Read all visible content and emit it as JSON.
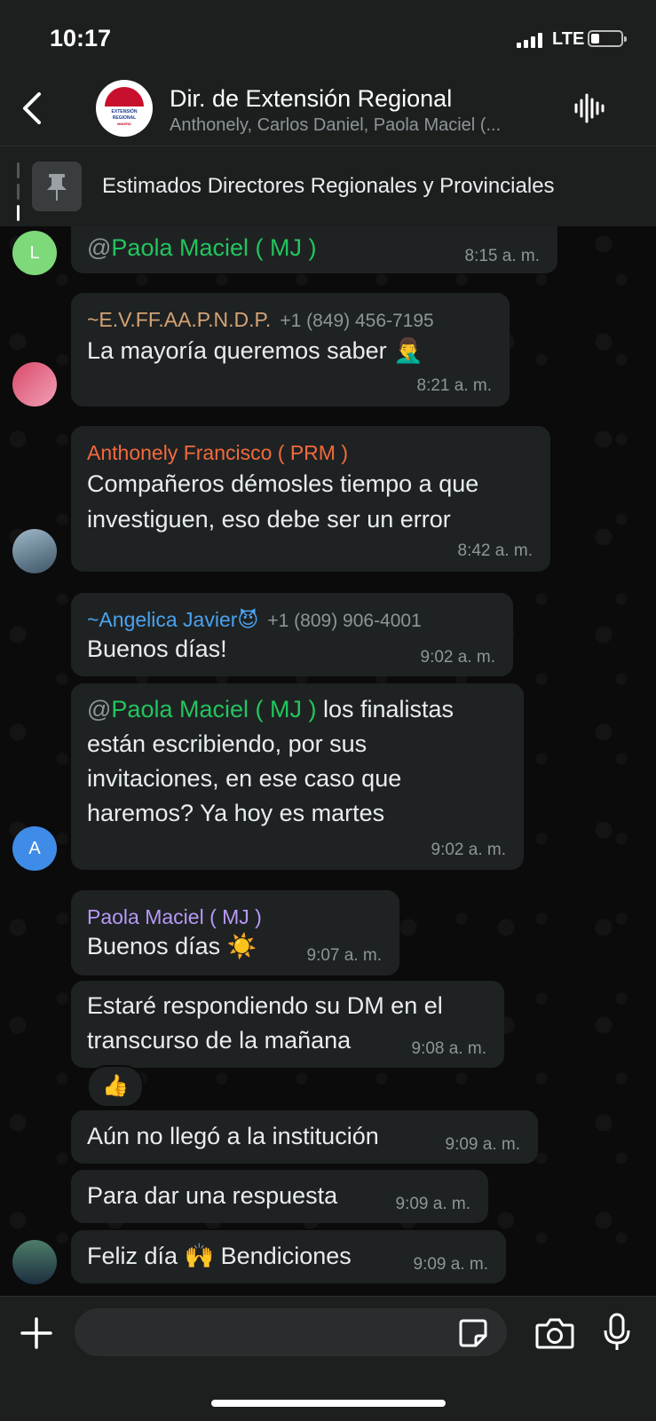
{
  "status_bar": {
    "time": "10:17",
    "network": "LTE"
  },
  "header": {
    "title": "Dir. de Extensión Regional",
    "subtitle": "Anthonely, Carlos Daniel, Paola Maciel (...",
    "logo_lines": [
      "EXTENSIÓN",
      "REGIONAL",
      "MINERD"
    ]
  },
  "pinned": {
    "text": "Estimados Directores Regionales y Provinciales"
  },
  "messages": [
    {
      "mention": "@",
      "mention_name": "Paola Maciel ( MJ )",
      "time": "8:15 a. m.",
      "avatar_letter": "L"
    },
    {
      "sender": "~E.V.FF.AA.P.N.D.P.",
      "phone": "+1 (849) 456-7195",
      "text": "La mayoría queremos saber 🤦‍♂️",
      "time": "8:21 a. m."
    },
    {
      "sender": "Anthonely Francisco ( PRM )",
      "text_lines": [
        "Compañeros démosles tiempo a que",
        "investiguen, eso debe ser un error"
      ],
      "time": "8:42 a. m."
    },
    {
      "sender": "~Angelica Javier😈",
      "phone": "+1 (809) 906-4001",
      "text": "Buenos días!",
      "time": "9:02 a. m."
    },
    {
      "mention": "@",
      "mention_name": "Paola Maciel ( MJ )",
      "text_rest": " los finalistas",
      "text_lines": [
        "están escribiendo, por sus",
        "invitaciones, en ese caso que",
        "haremos? Ya hoy es martes"
      ],
      "time": "9:02 a. m.",
      "avatar_letter": "A"
    },
    {
      "sender": "Paola Maciel ( MJ )",
      "text": "Buenos días ☀️",
      "time": "9:07 a. m."
    },
    {
      "text_lines": [
        "Estaré respondiendo su DM en el",
        "transcurso de la mañana"
      ],
      "time": "9:08 a. m.",
      "reaction": "👍"
    },
    {
      "text": "Aún no llegó a la institución",
      "time": "9:09 a. m."
    },
    {
      "text": "Para dar una respuesta",
      "time": "9:09 a. m."
    },
    {
      "text": "Feliz día 🙌 Bendiciones",
      "time": "9:09 a. m."
    }
  ],
  "colors": {
    "sender_1": "#d4a373",
    "sender_2": "#f26a3c",
    "sender_3": "#4aa3f0",
    "sender_4": "#b799f5",
    "mention": "#22c55e",
    "bubble": "#1f2223"
  },
  "icons": [
    "back-chevron-icon",
    "audio-wave-icon",
    "pin-icon",
    "plus-icon",
    "sticker-icon",
    "camera-icon",
    "microphone-icon"
  ]
}
